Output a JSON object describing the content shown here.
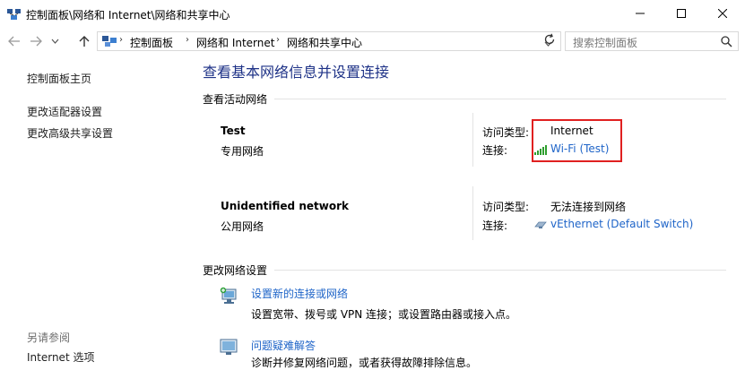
{
  "window": {
    "title": "控制面板\\网络和 Internet\\网络和共享中心"
  },
  "address": {
    "crumbs": [
      "控制面板",
      "网络和 Internet",
      "网络和共享中心"
    ],
    "search_placeholder": "搜索控制面板"
  },
  "left_pane": {
    "links": [
      "控制面板主页",
      "更改适配器设置",
      "更改高级共享设置"
    ],
    "see_also": "另请参阅",
    "see_also_links": [
      "Internet 选项"
    ]
  },
  "main": {
    "title": "查看基本网络信息并设置连接",
    "active_networks_header": "查看活动网络",
    "networks": [
      {
        "name": "Test",
        "type": "专用网络",
        "access_label": "访问类型:",
        "access_value": "Internet",
        "connection_label": "连接:",
        "connection_value": "Wi-Fi (Test)",
        "connection_icon": "wifi-signal-icon"
      },
      {
        "name": "Unidentified network",
        "type": "公用网络",
        "access_label": "访问类型:",
        "access_value": "无法连接到网络",
        "connection_label": "连接:",
        "connection_value": "vEthernet (Default Switch)",
        "connection_icon": "ethernet-icon"
      }
    ],
    "change_settings_header": "更改网络设置",
    "tasks": [
      {
        "link": "设置新的连接或网络",
        "desc": "设置宽带、拨号或 VPN 连接；或设置路由器或接入点。",
        "icon": "new-connection-icon"
      },
      {
        "link": "问题疑难解答",
        "desc": "诊断并修复网络问题，或者获得故障排除信息。",
        "icon": "troubleshoot-icon"
      }
    ]
  },
  "colors": {
    "title_blue": "#1e3287",
    "link_blue": "#1e64c8",
    "highlight_red": "#e02020"
  }
}
